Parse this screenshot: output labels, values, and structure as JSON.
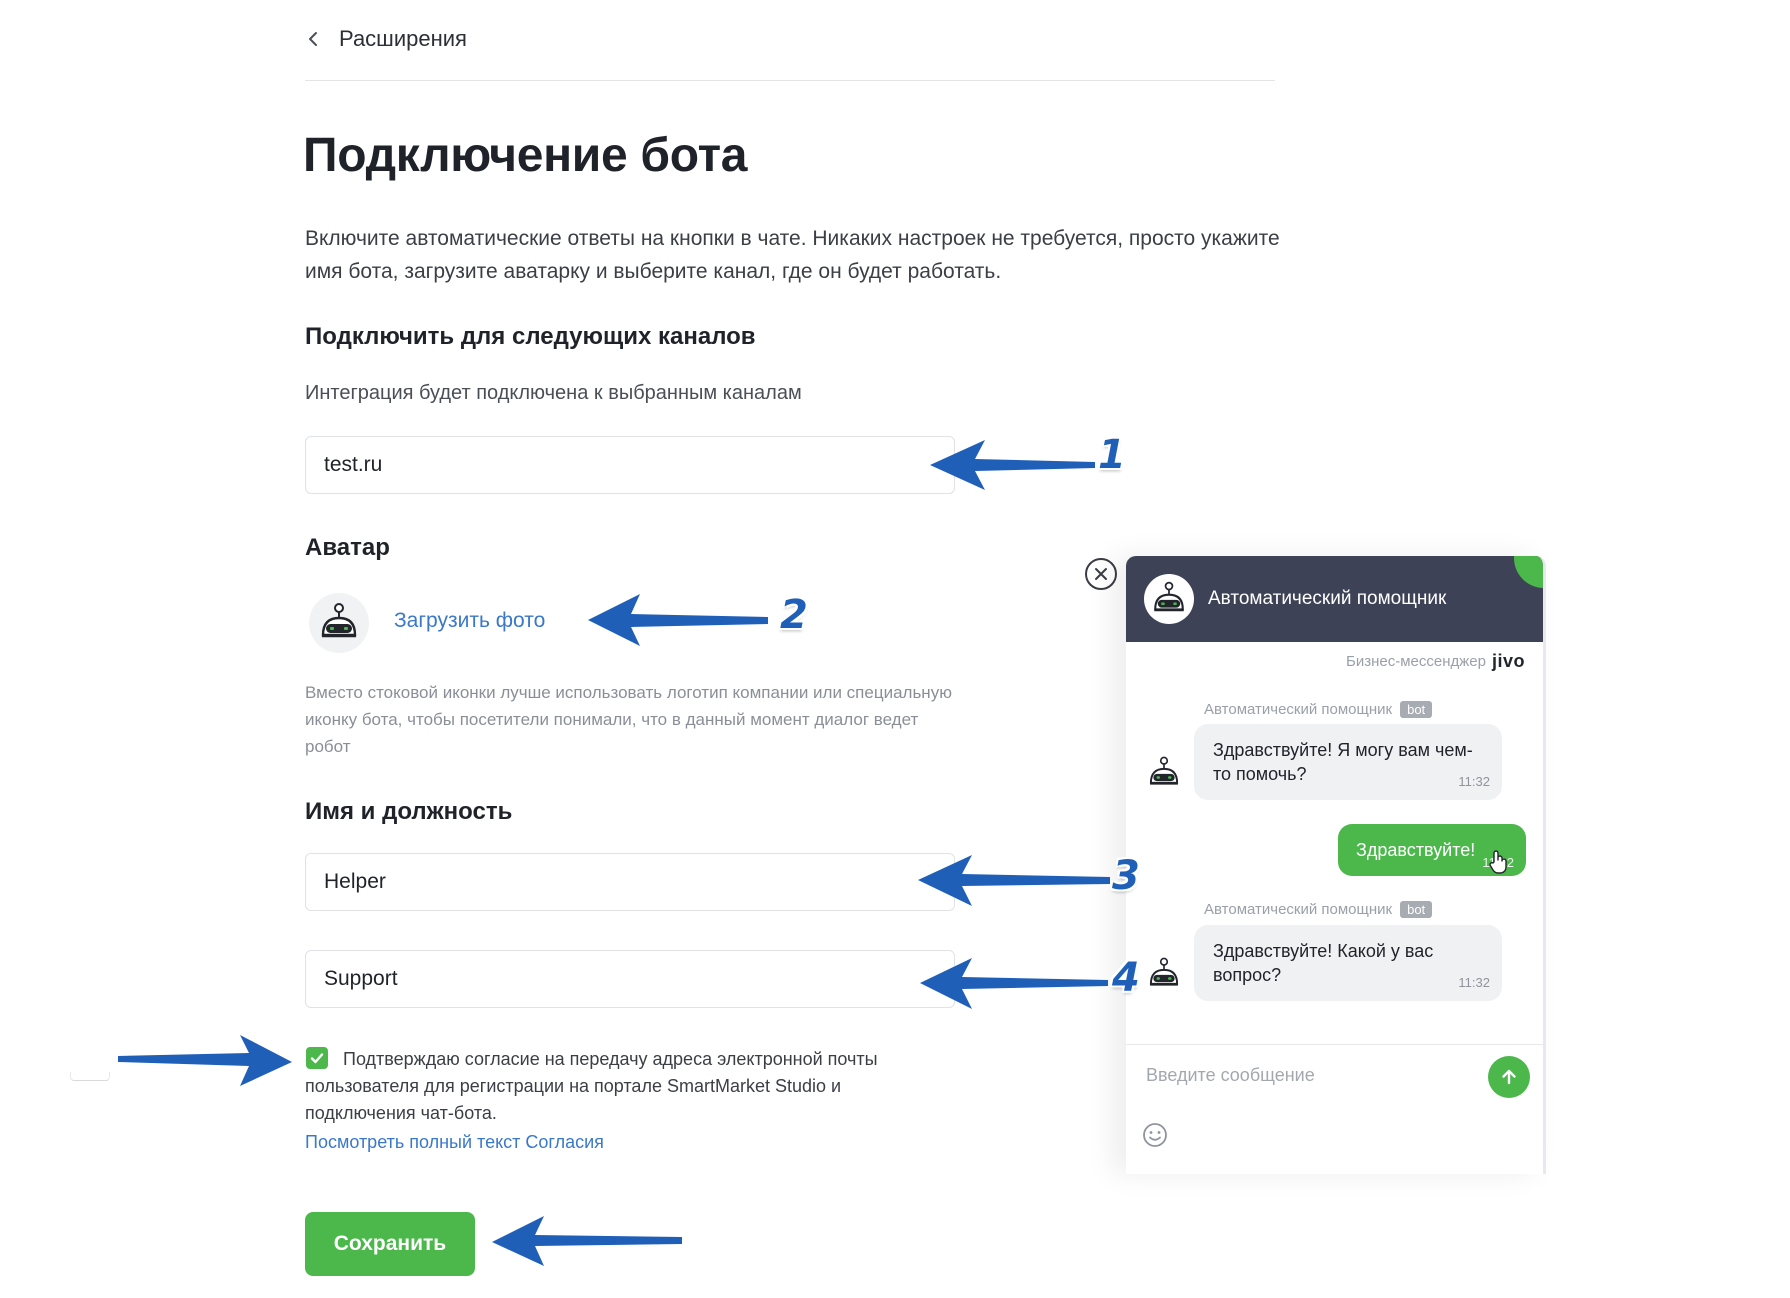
{
  "breadcrumb": {
    "label": "Расширения"
  },
  "page": {
    "title": "Подключение бота",
    "description": "Включите автоматические ответы на кнопки в чате. Никаких настроек не требуется, просто укажите имя бота, загрузите аватарку и выберите канал, где он будет работать."
  },
  "channels": {
    "heading": "Подключить для следующих каналов",
    "subtitle": "Интеграция будет подключена к выбранным каналам",
    "value": "test.ru"
  },
  "avatar": {
    "heading": "Аватар",
    "upload_label": "Загрузить фото",
    "hint": "Вместо стоковой иконки лучше использовать логотип компании или специальную иконку бота, чтобы посетители понимали, что в данный момент диалог ведет робот"
  },
  "identity": {
    "heading": "Имя и должность",
    "name_value": "Helper",
    "position_value": "Support"
  },
  "consent": {
    "checked": true,
    "text": "Подтверждаю согласие на передачу адреса электронной почты пользователя для регистрации на портале SmartMarket Studio и подключения чат-бота.",
    "link": "Посмотреть полный текст Согласия"
  },
  "save_label": "Сохранить",
  "widget": {
    "title": "Автоматический помощник",
    "brand_text": "Бизнес-мессенджер",
    "brand_logo": "jivo",
    "messages": [
      {
        "from": "bot",
        "author": "Автоматический помощник",
        "badge": "bot",
        "text": "Здравствуйте! Я могу вам чем-то помочь?",
        "time": "11:32"
      },
      {
        "from": "user",
        "text": "Здравствуйте!",
        "time": "11:32"
      },
      {
        "from": "bot",
        "author": "Автоматический помощник",
        "badge": "bot",
        "text": "Здравствуйте! Какой у вас вопрос?",
        "time": "11:32"
      }
    ],
    "composer_placeholder": "Введите сообщение"
  },
  "annotations": [
    "1",
    "2",
    "3",
    "4"
  ],
  "colors": {
    "accent_green": "#4cb84c",
    "link_blue": "#3a78c9",
    "header_dark": "#3e4256",
    "arrow_blue": "#1f5fb8"
  }
}
